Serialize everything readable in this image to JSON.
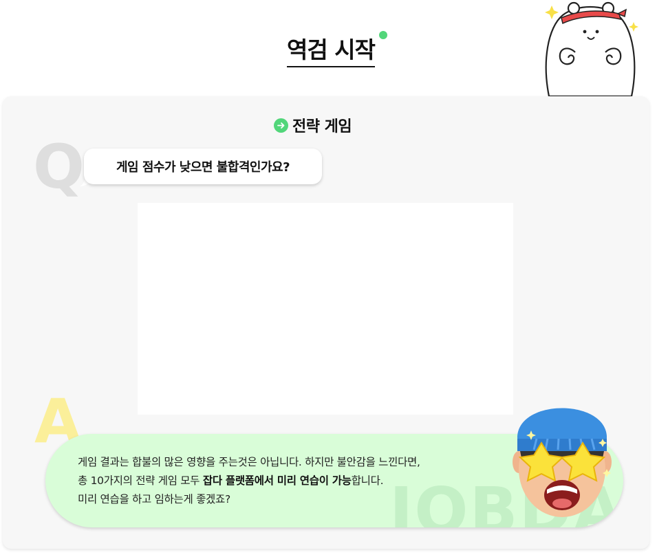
{
  "header": {
    "title": "역검 시작"
  },
  "section": {
    "title": "전략 게임"
  },
  "question": {
    "marker": "Q",
    "text": "게임 점수가 낮으면 불합격인가요?"
  },
  "answer": {
    "marker": "A",
    "line1": "게임 결과는 합불의 많은 영향을 주는것은 아닙니다. 하지만 불안감을 느낀다면,",
    "line2_pre": "총 10가지의 전략 게임 모두 ",
    "line2_bold": "잡다 플랫폼에서 미리 연습이 가능",
    "line2_post": "합니다.",
    "line3": "미리 연습을 하고 임하는게 좋겠죠?",
    "watermark": "JOBDA"
  },
  "colors": {
    "accent": "#52d67a",
    "answer_bg": "#d9fdd8",
    "q_marker": "#dedede",
    "a_marker": "#fbef9a"
  },
  "icons": {
    "section": "arrow-right-circle-icon"
  }
}
